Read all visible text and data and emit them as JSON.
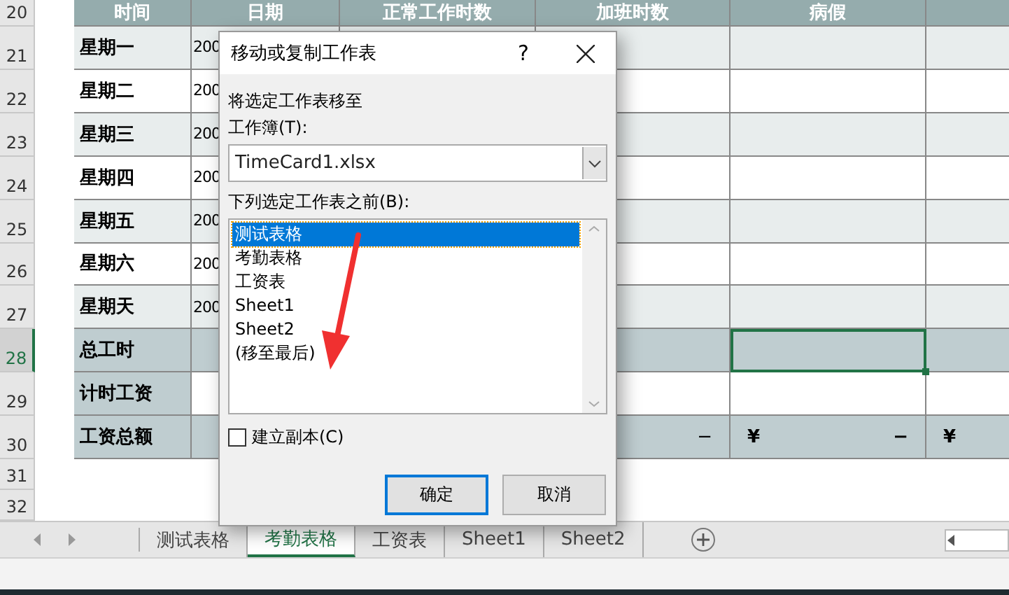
{
  "sheet": {
    "rows": [
      {
        "number": "20",
        "kind": "header",
        "selected": false,
        "cells": [
          "时间",
          "日期",
          "正常工作时数",
          "加班时数",
          "病假"
        ]
      },
      {
        "number": "21",
        "kind": "day",
        "color": "#e8eded",
        "selected": false,
        "label": "星期一",
        "date": "200"
      },
      {
        "number": "22",
        "kind": "day",
        "color": "#ffffff",
        "selected": false,
        "label": "星期二",
        "date": "200"
      },
      {
        "number": "23",
        "kind": "day",
        "color": "#e8eded",
        "selected": false,
        "label": "星期三",
        "date": "200"
      },
      {
        "number": "24",
        "kind": "day",
        "color": "#ffffff",
        "selected": false,
        "label": "星期四",
        "date": "200"
      },
      {
        "number": "25",
        "kind": "day",
        "color": "#e8eded",
        "selected": false,
        "label": "星期五",
        "date": "200"
      },
      {
        "number": "26",
        "kind": "day",
        "color": "#ffffff",
        "selected": false,
        "label": "星期六",
        "date": "200"
      },
      {
        "number": "27",
        "kind": "day",
        "color": "#e8eded",
        "selected": false,
        "label": "星期天",
        "date": "200"
      },
      {
        "number": "28",
        "kind": "total",
        "color": "#bfcdd0",
        "filled": true,
        "selected": true,
        "label": "总工时"
      },
      {
        "number": "29",
        "kind": "total",
        "color": "#bfcdd0",
        "filled": false,
        "selected": false,
        "label": "计时工资"
      },
      {
        "number": "30",
        "kind": "total",
        "color": "#bfcdd0",
        "filled": true,
        "selected": false,
        "label": "工资总额",
        "overtime": "−",
        "sick_currency": "¥",
        "sick": "−",
        "column_7_currency": "¥"
      },
      {
        "number": "31",
        "kind": "empty",
        "selected": false
      },
      {
        "number": "32",
        "kind": "empty",
        "selected": false
      }
    ]
  },
  "dialog": {
    "title": "移动或复制工作表",
    "help": "?",
    "prompt": "将选定工作表移至",
    "workbook_label": "工作簿(T):",
    "workbook": "TimeCard1.xlsx",
    "before_label": "下列选定工作表之前(B):",
    "sheets": [
      {
        "label": "测试表格",
        "selected": true
      },
      {
        "label": "考勤表格",
        "selected": false
      },
      {
        "label": "工资表",
        "selected": false
      },
      {
        "label": "Sheet1",
        "selected": false
      },
      {
        "label": "Sheet2",
        "selected": false
      },
      {
        "label": "(移至最后)",
        "selected": false
      }
    ],
    "copy": {
      "label": "建立副本(C)",
      "checked": false
    },
    "buttons": [
      {
        "label": "确定",
        "default": true
      },
      {
        "label": "取消",
        "default": false
      }
    ]
  },
  "tabs": [
    {
      "label": "测试表格",
      "selected": false
    },
    {
      "label": "考勤表格",
      "selected": true
    },
    {
      "label": "工资表",
      "selected": false
    },
    {
      "label": "Sheet1",
      "selected": false
    },
    {
      "label": "Sheet2",
      "selected": false
    }
  ]
}
